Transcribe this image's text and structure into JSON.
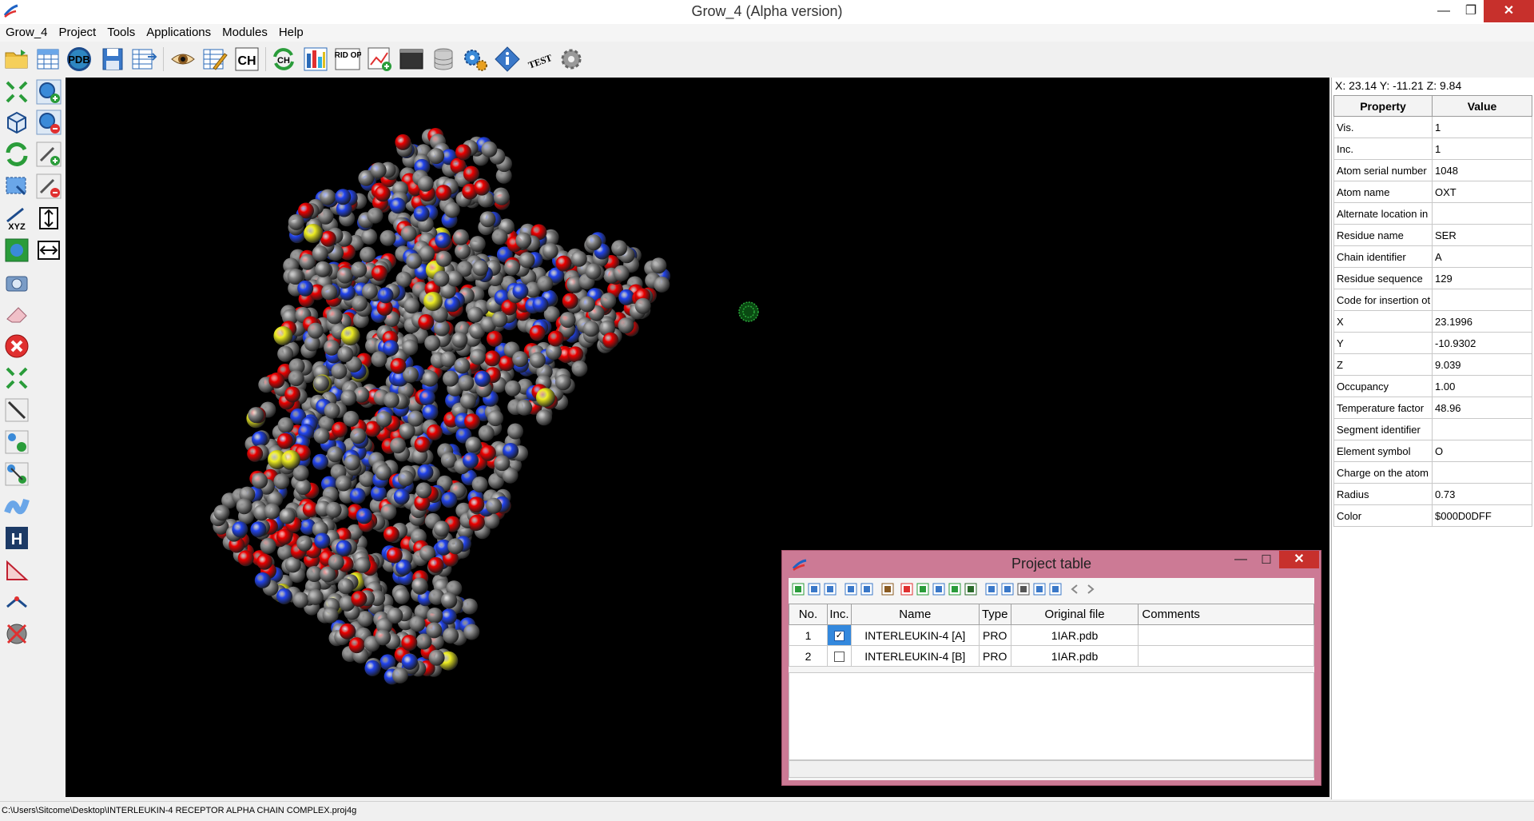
{
  "window": {
    "title": "Grow_4 (Alpha version)",
    "min_glyph": "—",
    "max_glyph": "❐",
    "close_glyph": "✕"
  },
  "menu": [
    "Grow_4",
    "Project",
    "Tools",
    "Applications",
    "Modules",
    "Help"
  ],
  "toolbar": {
    "icons": [
      "open-folder-icon",
      "new-table-icon",
      "pdb-icon",
      "save-icon",
      "table-export-icon",
      "view-eye-icon",
      "edit-table-icon",
      "ch-icon",
      "ch-refresh-icon",
      "grid-color-icon",
      "grid-opt-icon",
      "chart-add-icon",
      "terminal-icon",
      "database-icon",
      "settings-gears-icon",
      "info-diamond-icon",
      "test-icon",
      "gear-gray-icon"
    ],
    "pdb_label": "PDB",
    "gridopt_label": "GRID OPT",
    "test_label": "TEST"
  },
  "left_tools": {
    "icons": [
      "arrows-inward-icon",
      "zoom-add-icon",
      "cube-icon",
      "zoom-remove-icon",
      "rotate-icon",
      "pen-add-icon",
      "select-icon",
      "pen-remove-icon",
      "xyz-axis-icon",
      "fit-height-icon",
      "move-atom-icon",
      "fit-width-icon",
      "camera-icon",
      "eraser-icon",
      "delete-icon",
      "arrows-outward-icon",
      "bond-line-icon",
      "atom-pair-icon",
      "bond-link-icon",
      "ribbon-icon",
      "h-bond-icon",
      "triangle-icon",
      "angle-icon",
      "remove-atom-icon"
    ],
    "xyz_label": "XYZ"
  },
  "viewport": {
    "background": "#000000",
    "atom_colors": {
      "carbon": "#8a8a8a",
      "oxygen": "#ee0000",
      "nitrogen": "#2244ee",
      "sulfur": "#eeee22"
    }
  },
  "coords_text": "X: 23.14 Y: -11.21 Z: 9.84",
  "properties": {
    "header": [
      "Property",
      "Value"
    ],
    "rows": [
      [
        "Vis.",
        "1"
      ],
      [
        "Inc.",
        "1"
      ],
      [
        "Atom serial number",
        "1048"
      ],
      [
        "Atom name",
        "OXT"
      ],
      [
        "Alternate location in",
        ""
      ],
      [
        "Residue name",
        "SER"
      ],
      [
        "Chain identifier",
        "A"
      ],
      [
        "Residue sequence",
        "129"
      ],
      [
        "Code for insertion ot",
        ""
      ],
      [
        "X",
        "23.1996"
      ],
      [
        "Y",
        "-10.9302"
      ],
      [
        "Z",
        "9.039"
      ],
      [
        "Occupancy",
        "1.00"
      ],
      [
        "Temperature factor",
        "48.96"
      ],
      [
        "Segment identifier",
        ""
      ],
      [
        "Element symbol",
        "O"
      ],
      [
        "Charge on the atom",
        ""
      ],
      [
        "Radius",
        "0.73"
      ],
      [
        "Color",
        "$000D0DFF"
      ]
    ]
  },
  "project_table": {
    "title": "Project table",
    "close_glyph": "✕",
    "min_glyph": "—",
    "max_glyph": "☐",
    "columns": [
      "No.",
      "Inc.",
      "Name",
      "Type",
      "Original file",
      "Comments"
    ],
    "rows": [
      {
        "no": "1",
        "inc": true,
        "name": "INTERLEUKIN-4 [A]",
        "type": "PRO",
        "file": "1IAR.pdb",
        "comments": ""
      },
      {
        "no": "2",
        "inc": false,
        "name": "INTERLEUKIN-4 [B]",
        "type": "PRO",
        "file": "1IAR.pdb",
        "comments": ""
      }
    ],
    "toolbar_icons": [
      "add-row-icon",
      "copy-row-icon",
      "save-small-icon",
      "import-icon",
      "export-icon",
      "eye-small-icon",
      "delete-row-icon",
      "split-icon",
      "edit-small-icon",
      "filter-icon",
      "table-chart-icon",
      "search-small-icon",
      "grid-small-icon",
      "attach-icon",
      "duplicate-icon",
      "diamond-small-icon",
      "arrow-left-icon",
      "arrow-right-icon"
    ]
  },
  "status_text": "C:\\Users\\Sitcome\\Desktop\\INTERLEUKIN-4 RECEPTOR ALPHA CHAIN COMPLEX.proj4g"
}
